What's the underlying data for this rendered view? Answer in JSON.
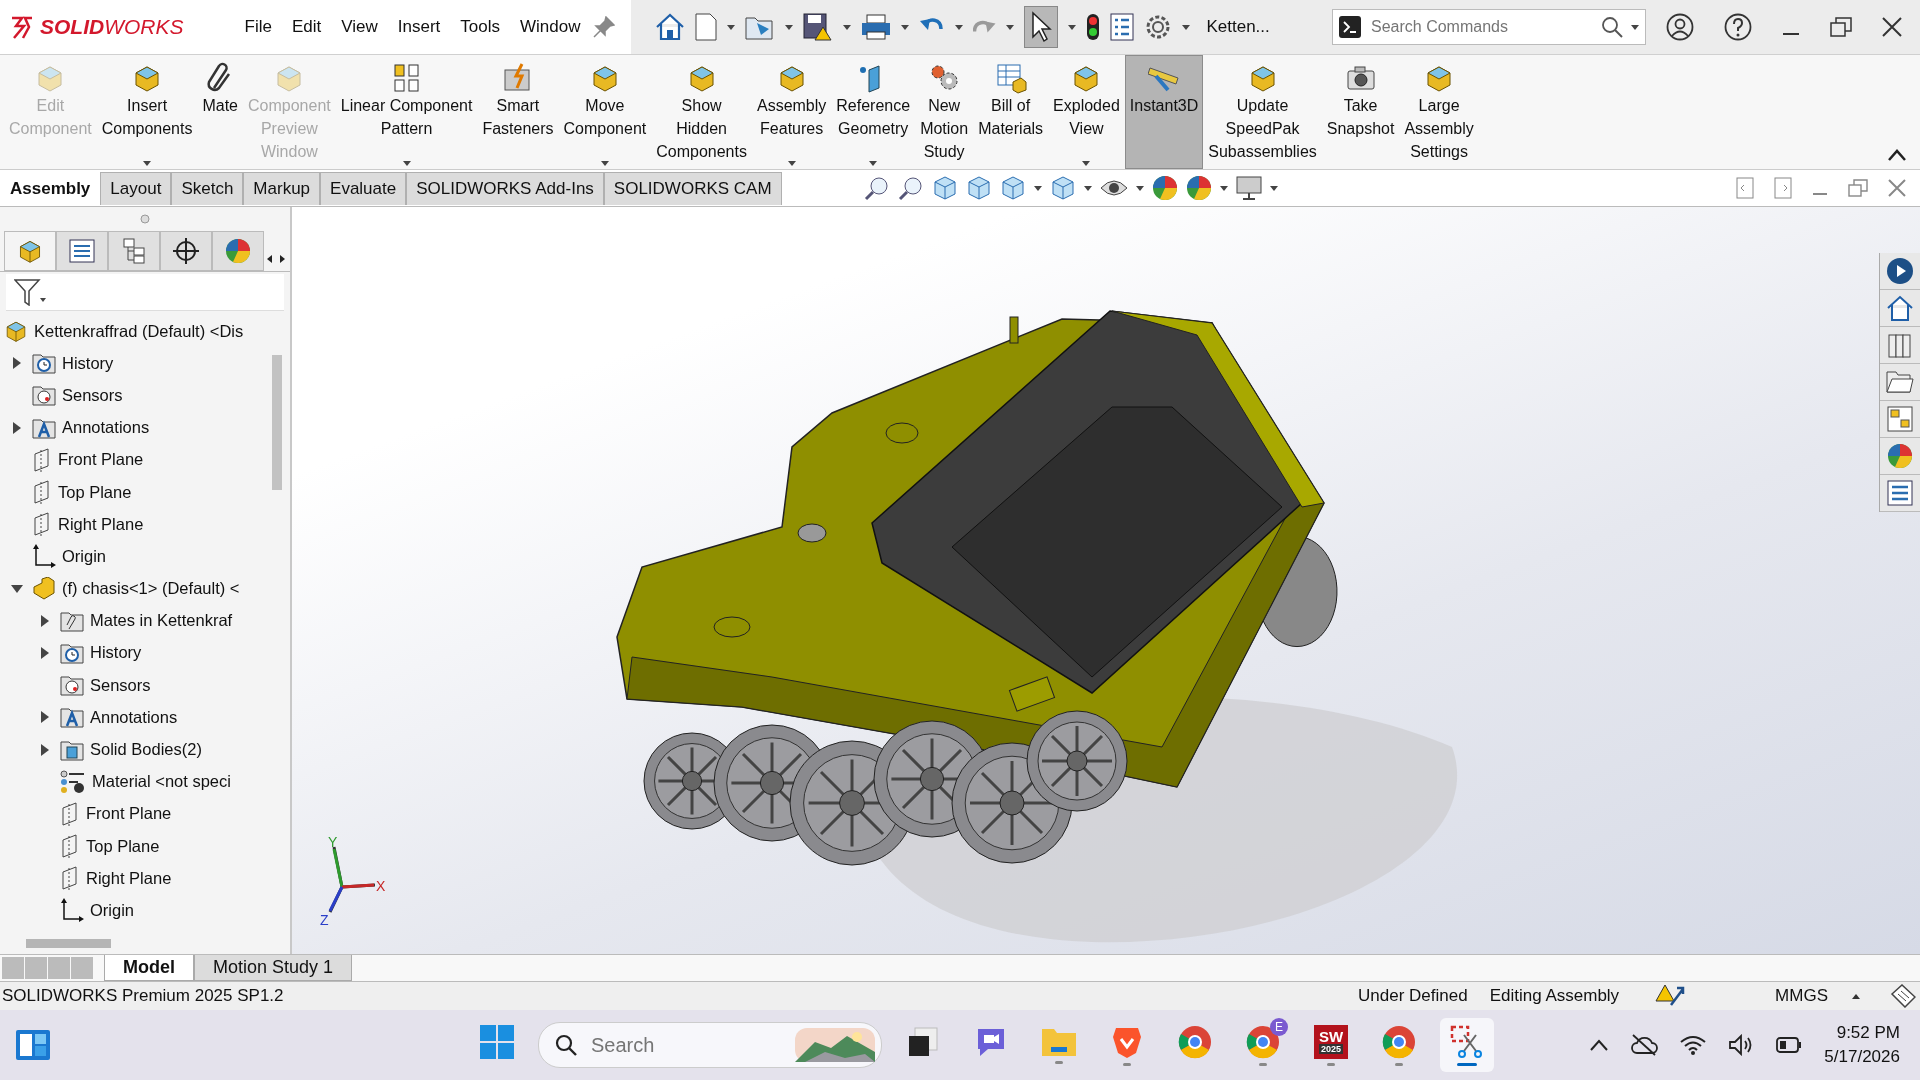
{
  "title_bar": {
    "logo": "**SOLID**WORKS",
    "menus": [
      "File",
      "Edit",
      "View",
      "Insert",
      "Tools",
      "Window"
    ],
    "document": "Ketten...",
    "search": {
      "placeholder": "Search Commands"
    }
  },
  "ribbon": [
    {
      "label": "Edit\nComponent",
      "disabled": true,
      "dropdown": false,
      "selected": false
    },
    {
      "label": "Insert\nComponents",
      "disabled": false,
      "dropdown": true,
      "selected": false
    },
    {
      "label": "Mate",
      "disabled": false,
      "dropdown": false,
      "selected": false
    },
    {
      "label": "Component\nPreview\nWindow",
      "disabled": true,
      "dropdown": false,
      "selected": false
    },
    {
      "label": "Linear Component\nPattern",
      "disabled": false,
      "dropdown": true,
      "selected": false
    },
    {
      "label": "Smart\nFasteners",
      "disabled": false,
      "dropdown": false,
      "selected": false
    },
    {
      "label": "Move\nComponent",
      "disabled": false,
      "dropdown": true,
      "selected": false
    },
    {
      "label": "Show\nHidden\nComponents",
      "disabled": false,
      "dropdown": false,
      "selected": false
    },
    {
      "label": "Assembly\nFeatures",
      "disabled": false,
      "dropdown": true,
      "selected": false
    },
    {
      "label": "Reference\nGeometry",
      "disabled": false,
      "dropdown": true,
      "selected": false
    },
    {
      "label": "New\nMotion\nStudy",
      "disabled": false,
      "dropdown": false,
      "selected": false
    },
    {
      "label": "Bill of\nMaterials",
      "disabled": false,
      "dropdown": false,
      "selected": false
    },
    {
      "label": "Exploded\nView",
      "disabled": false,
      "dropdown": true,
      "selected": false
    },
    {
      "label": "Instant3D",
      "disabled": false,
      "dropdown": false,
      "selected": true
    },
    {
      "label": "Update\nSpeedPak\nSubassemblies",
      "disabled": false,
      "dropdown": false,
      "selected": false
    },
    {
      "label": "Take\nSnapshot",
      "disabled": false,
      "dropdown": false,
      "selected": false
    },
    {
      "label": "Large\nAssembly\nSettings",
      "disabled": false,
      "dropdown": false,
      "selected": false
    }
  ],
  "tabs": [
    {
      "label": "Assembly",
      "selected": true
    },
    {
      "label": "Layout",
      "selected": false
    },
    {
      "label": "Sketch",
      "selected": false
    },
    {
      "label": "Markup",
      "selected": false
    },
    {
      "label": "Evaluate",
      "selected": false
    },
    {
      "label": "SOLIDWORKS Add-Ins",
      "selected": false
    },
    {
      "label": "SOLIDWORKS CAM",
      "selected": false
    }
  ],
  "tree": {
    "label": "Kettenkraffrad (Default) <Dis",
    "kind": "assembly",
    "children": [
      {
        "label": "History",
        "kind": "history",
        "expanded": false
      },
      {
        "label": "Sensors",
        "kind": "sensor"
      },
      {
        "label": "Annotations",
        "kind": "annotation",
        "expanded": false
      },
      {
        "label": "Front Plane",
        "kind": "plane"
      },
      {
        "label": "Top Plane",
        "kind": "plane"
      },
      {
        "label": "Right Plane",
        "kind": "plane"
      },
      {
        "label": "Origin",
        "kind": "origin"
      },
      {
        "label": "(f) chasis<1> (Default) <",
        "kind": "part",
        "expanded": true,
        "children": [
          {
            "label": "Mates in Kettenkraf",
            "kind": "mates",
            "expanded": false
          },
          {
            "label": "History",
            "kind": "history",
            "expanded": false
          },
          {
            "label": "Sensors",
            "kind": "sensor"
          },
          {
            "label": "Annotations",
            "kind": "annotation",
            "expanded": false
          },
          {
            "label": "Solid Bodies(2)",
            "kind": "bodies",
            "expanded": false
          },
          {
            "label": "Material <not speci",
            "kind": "material"
          },
          {
            "label": "Front Plane",
            "kind": "plane"
          },
          {
            "label": "Top Plane",
            "kind": "plane"
          },
          {
            "label": "Right Plane",
            "kind": "plane"
          },
          {
            "label": "Origin",
            "kind": "origin"
          }
        ]
      }
    ]
  },
  "triad": {
    "x": "X",
    "y": "Y",
    "z": "Z"
  },
  "bottom_tabs": [
    {
      "label": "Model",
      "selected": true
    },
    {
      "label": "Motion Study 1",
      "selected": false
    }
  ],
  "status_bar": {
    "product": "SOLIDWORKS Premium 2025 SP1.2",
    "state": "Under Defined",
    "mode": "Editing Assembly",
    "units": "MMGS"
  },
  "taskbar": {
    "search": {
      "placeholder": "Search"
    },
    "apps": [
      {
        "kind": "start",
        "running": false,
        "selected": false
      },
      {
        "kind": "taskview",
        "running": false,
        "selected": false
      },
      {
        "kind": "meet",
        "running": false,
        "selected": false
      },
      {
        "kind": "explorer",
        "running": true,
        "selected": false
      },
      {
        "kind": "brave",
        "running": true,
        "selected": false
      },
      {
        "kind": "chrome",
        "running": false,
        "selected": false
      },
      {
        "kind": "chrome",
        "running": true,
        "selected": false,
        "badge": "E"
      },
      {
        "kind": "solidworks",
        "running": true,
        "selected": false,
        "text": "SW",
        "sub": "2025"
      },
      {
        "kind": "chrome",
        "running": true,
        "selected": false
      },
      {
        "kind": "snipping",
        "running": true,
        "selected": true
      }
    ],
    "time": "9:52 PM",
    "date": "5/17/2026"
  }
}
